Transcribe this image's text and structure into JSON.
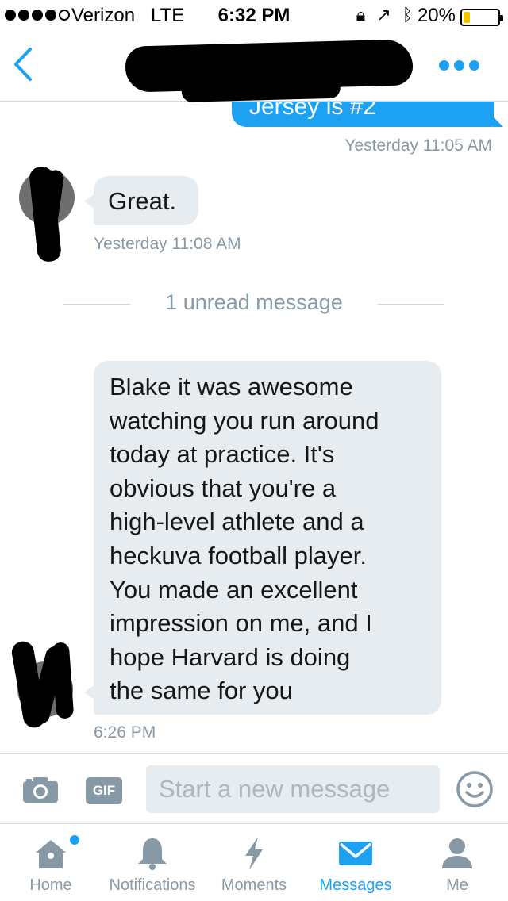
{
  "status_bar": {
    "carrier": "Verizon",
    "network": "LTE",
    "time": "6:32 PM",
    "battery_percent": "20%",
    "battery_level": 0.2,
    "icons": [
      "rotation-lock-icon",
      "location-arrow-icon",
      "bluetooth-icon"
    ]
  },
  "header": {
    "back_icon": "chevron-left-icon",
    "more_icon": "more-dots-icon"
  },
  "messages": [
    {
      "type": "sent",
      "text": "Jersey is #2",
      "time": "Yesterday 11:05 AM"
    },
    {
      "type": "received",
      "text": "Great.",
      "time": "Yesterday 11:08 AM"
    },
    {
      "type": "divider",
      "text": "1 unread message"
    },
    {
      "type": "received",
      "text": "Blake it was awesome\nwatching you run around\ntoday at practice. It's\nobvious that you're a\nhigh-level athlete and a\nheckuva football player.\nYou made an excellent\nimpression on me, and I\nhope Harvard is doing\nthe same for you",
      "time": "6:26 PM"
    }
  ],
  "composer": {
    "placeholder": "Start a new message",
    "value": "",
    "gif_label": "GIF"
  },
  "tabs": [
    {
      "label": "Home",
      "icon": "home-icon",
      "active": false,
      "has_dot": true
    },
    {
      "label": "Notifications",
      "icon": "bell-icon",
      "active": false
    },
    {
      "label": "Moments",
      "icon": "lightning-icon",
      "active": false
    },
    {
      "label": "Messages",
      "icon": "envelope-icon",
      "active": true
    },
    {
      "label": "Me",
      "icon": "person-icon",
      "active": false
    }
  ],
  "colors": {
    "accent": "#1da1f2",
    "received_bubble": "#e6ecf0",
    "muted_text": "#8899a6",
    "battery_fill": "#f5c400"
  }
}
